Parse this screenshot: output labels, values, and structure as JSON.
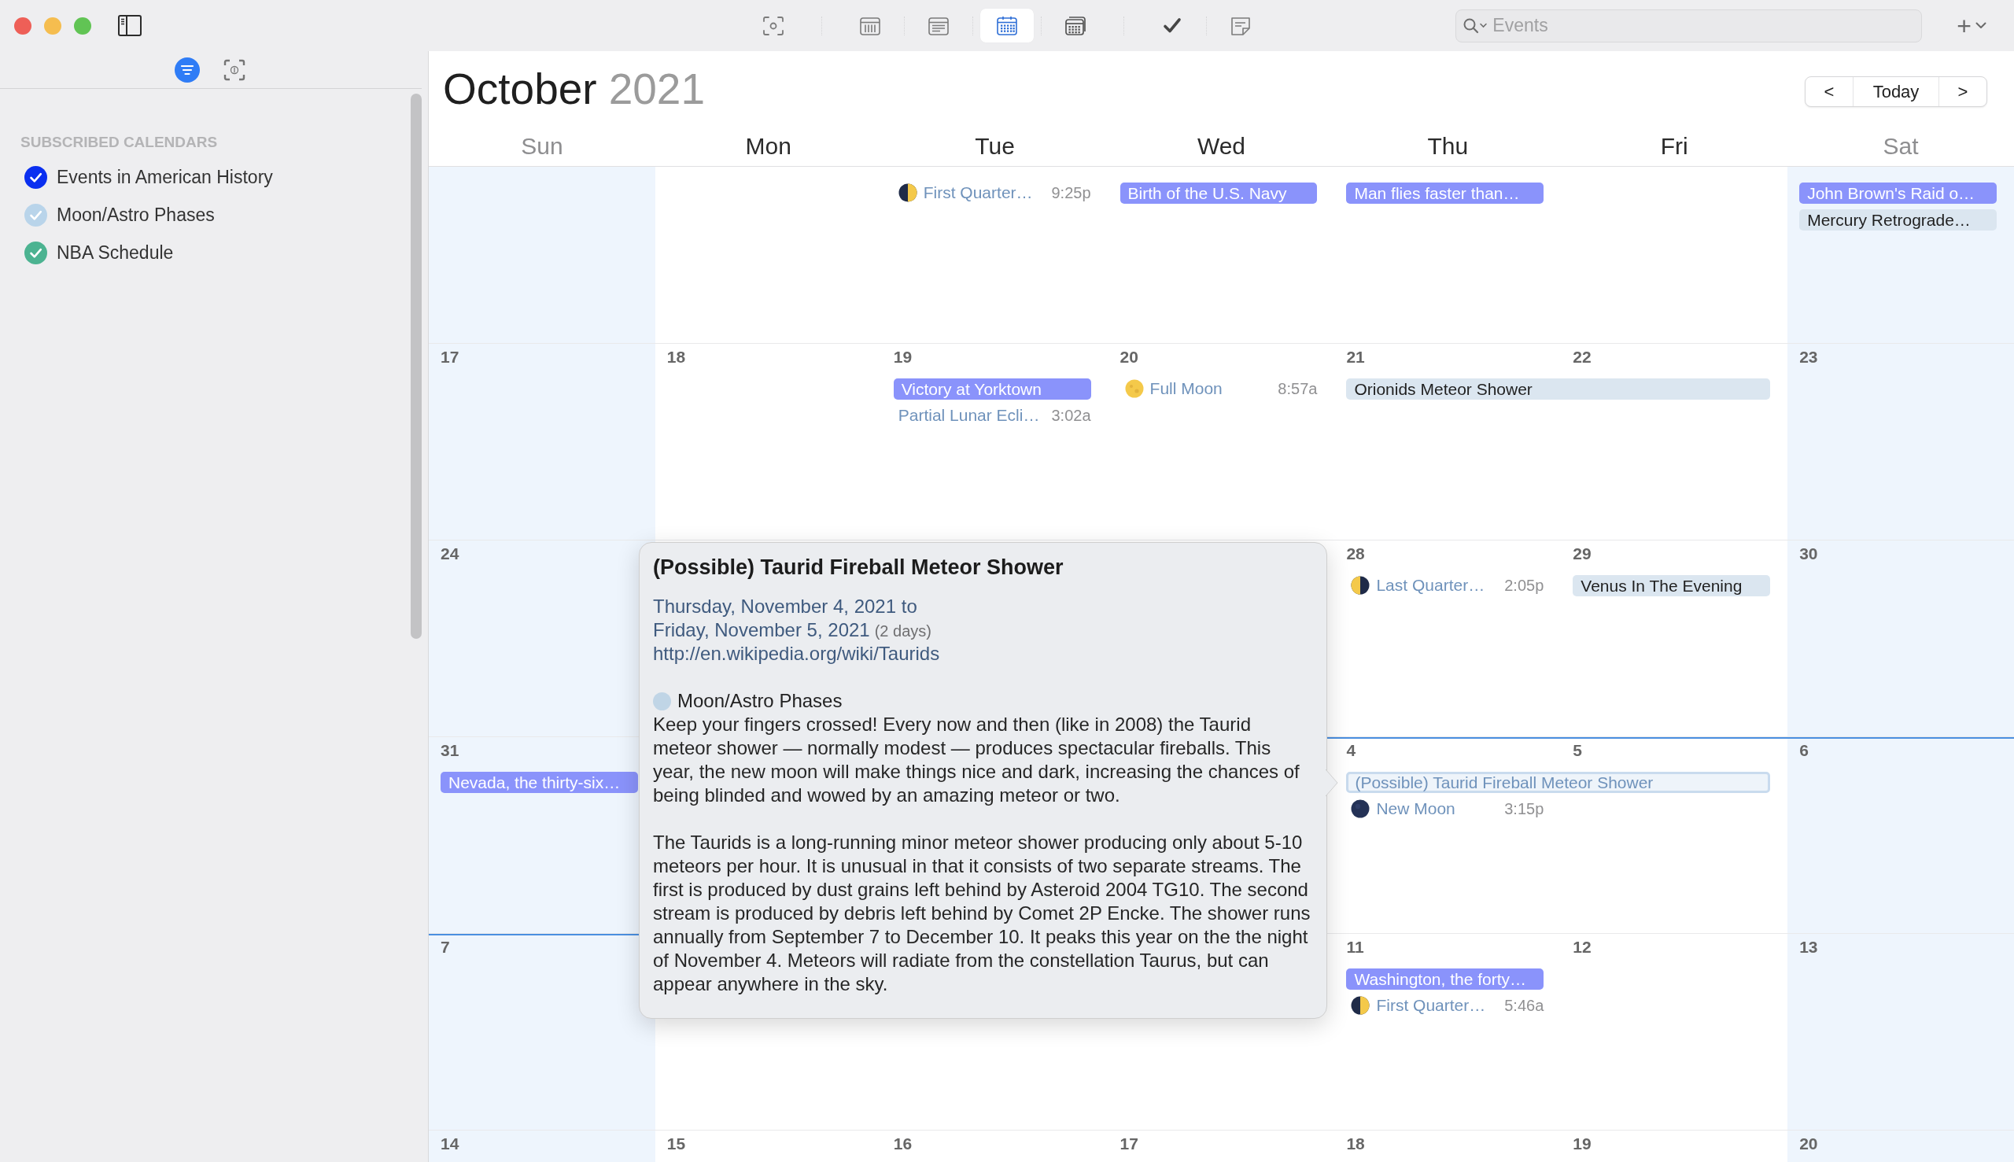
{
  "toolbar": {
    "view_buttons": [
      {
        "kind": "viewfinder",
        "selected": false
      },
      {
        "kind": "calendar_columns",
        "selected": false
      },
      {
        "kind": "calendar_rows",
        "selected": false
      },
      {
        "kind": "calendar_grid",
        "selected": true
      },
      {
        "kind": "calendar_stack",
        "selected": false
      },
      {
        "kind": "checkmark",
        "selected": false
      },
      {
        "kind": "note",
        "selected": false
      }
    ],
    "search": {
      "placeholder": "Events"
    },
    "add_button": {
      "label": "+"
    }
  },
  "sidebar": {
    "tabs": [
      {
        "kind": "filter",
        "selected": true
      },
      {
        "kind": "frame_info",
        "selected": false
      }
    ],
    "section_title": "SUBSCRIBED CALENDARS",
    "calendars": [
      {
        "name": "Events in American History",
        "checked": true,
        "color": "#0a2ff0"
      },
      {
        "name": "Moon/Astro Phases",
        "checked": true,
        "color": "#b9d4ea"
      },
      {
        "name": "NBA Schedule",
        "checked": true,
        "color": "#4cb391"
      }
    ]
  },
  "calendar": {
    "month": "October",
    "year": "2021",
    "navigation": {
      "previous": "<",
      "today": "Today",
      "next": ">"
    },
    "weekdays": [
      "Sun",
      "Mon",
      "Tue",
      "Wed",
      "Thu",
      "Fri",
      "Sat"
    ],
    "weeks": [
      {
        "tue": {
          "events": [
            {
              "kind": "firstquarter",
              "title": "First Quarter…",
              "time": "9:25p",
              "color": "#6f92bb",
              "selected": false
            }
          ]
        },
        "wed": {
          "events": [
            {
              "kind": "chip",
              "title": "Birth of the U.S. Navy",
              "color": "#8a93fb",
              "selected": false,
              "spans_next_day": false
            }
          ]
        },
        "thu": {
          "events": [
            {
              "kind": "chip",
              "title": "Man flies faster than…",
              "color": "#8a93fb",
              "selected": false,
              "spans_next_day": false
            }
          ]
        },
        "sat": {
          "events": [
            {
              "kind": "chip",
              "title": "John Brown's Raid o…",
              "color": "#8a93fb",
              "selected": false,
              "spans_next_day": false
            },
            {
              "kind": "chip",
              "title": "Mercury Retrograde…",
              "color": "#dbe6f0",
              "selected": false,
              "spans_next_day": false
            }
          ]
        }
      },
      {
        "sun": {
          "number": "17"
        },
        "mon": {
          "number": "18"
        },
        "tue": {
          "number": "19",
          "events": [
            {
              "kind": "chip",
              "title": "Victory at Yorktown",
              "color": "#8a93fb",
              "selected": false,
              "spans_next_day": false
            },
            {
              "kind": "timed",
              "title": "Partial Lunar Ecli…",
              "time": "3:02a",
              "color": "#6f92bb",
              "selected": false
            }
          ]
        },
        "wed": {
          "number": "20",
          "events": [
            {
              "kind": "fullmoon",
              "title": "Full Moon",
              "time": "8:57a",
              "color": "#6f92bb",
              "selected": false
            }
          ]
        },
        "thu": {
          "number": "21",
          "events": [
            {
              "kind": "chip",
              "title": "Orionids Meteor Shower",
              "color": "#dbe6f0",
              "selected": false,
              "spans_next_day": true
            }
          ]
        },
        "fri": {
          "number": "22"
        },
        "sat": {
          "number": "23"
        }
      },
      {
        "sun": {
          "number": "24"
        },
        "thu": {
          "number": "28",
          "events": [
            {
              "kind": "lastquarter",
              "title": "Last Quarter…",
              "time": "2:05p",
              "color": "#6f92bb",
              "selected": false
            }
          ]
        },
        "fri": {
          "number": "29",
          "events": [
            {
              "kind": "chip",
              "title": "Venus In The Evening",
              "color": "#dbe6f0",
              "selected": false,
              "spans_next_day": false
            }
          ]
        },
        "sat": {
          "number": "30"
        }
      },
      {
        "sun": {
          "number": "31",
          "events": [
            {
              "kind": "chip",
              "title": "Nevada, the thirty-six…",
              "color": "#8a93fb",
              "selected": false,
              "spans_next_day": false
            }
          ]
        },
        "mon": {
          "month_start": true
        },
        "thu": {
          "number": "4",
          "events": [
            {
              "kind": "chip",
              "title": "(Possible) Taurid Fireball Meteor Shower",
              "color": "#6f92bb",
              "selected": true,
              "spans_next_day": true
            },
            {
              "kind": "newmoon",
              "title": "New Moon",
              "time": "3:15p",
              "color": "#6f92bb",
              "selected": false
            }
          ]
        },
        "fri": {
          "number": "5"
        },
        "sat": {
          "number": "6"
        }
      },
      {
        "sun": {
          "number": "7"
        },
        "thu": {
          "number": "11",
          "events": [
            {
              "kind": "chip",
              "title": "Washington, the forty…",
              "color": "#8a93fb",
              "selected": false,
              "spans_next_day": false
            },
            {
              "kind": "firstquarter",
              "title": "First Quarter…",
              "time": "5:46a",
              "color": "#6f92bb",
              "selected": false
            }
          ]
        },
        "fri": {
          "number": "12"
        },
        "sat": {
          "number": "13"
        }
      },
      {
        "sun": {
          "number": "14"
        },
        "mon": {
          "number": "15"
        },
        "tue": {
          "number": "16"
        },
        "wed": {
          "number": "17"
        },
        "thu": {
          "number": "18"
        },
        "fri": {
          "number": "19"
        },
        "sat": {
          "number": "20"
        }
      }
    ]
  },
  "popover": {
    "title": "(Possible) Taurid Fireball Meteor Shower",
    "start_date": "Thursday, November 4, 2021 to",
    "end_date": "Friday, November 5, 2021",
    "duration": "(2 days)",
    "url": "http://en.wikipedia.org/wiki/Taurids",
    "calendar": {
      "name": "Moon/Astro Phases",
      "color": "#c0d5e6"
    },
    "notes": [
      "Keep your fingers crossed! Every now and then (like in 2008) the Taurid meteor shower — normally modest — produces spectacular fireballs. This year, the new moon will make things nice and dark, increasing the chances of being blinded and wowed by an amazing meteor or two.",
      "The Taurids is a long-running minor meteor shower producing only about 5-10 meteors per hour. It is unusual in that it consists of two separate streams. The first is produced by dust grains left behind by Asteroid 2004 TG10. The second stream is produced by debris left behind by Comet 2P Encke. The shower runs annually from September 7 to December 10. It peaks this year on the the night of November 4. Meteors will radiate from the constellation Taurus, but can appear anywhere in the sky."
    ]
  }
}
